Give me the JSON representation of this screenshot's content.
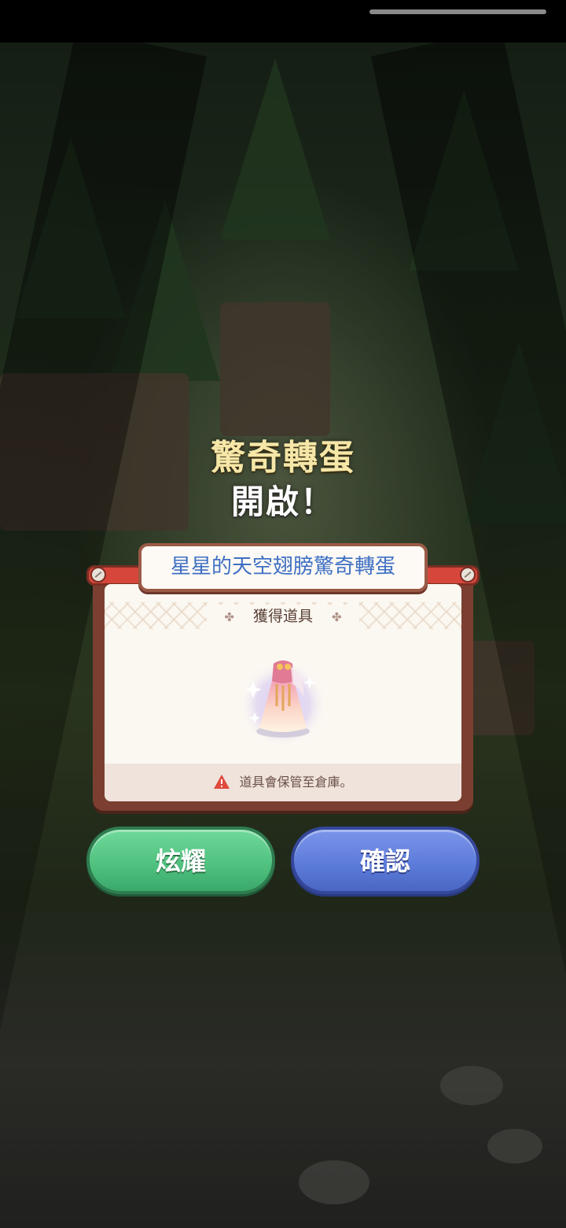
{
  "popup": {
    "title_line1": "驚奇轉蛋",
    "title_line2": "開啟！",
    "gacha_name": "星星的天空翅膀驚奇轉蛋",
    "reward_label": "獲得道具",
    "reward_item_icon": "dress-icon",
    "storage_notice": "道具會保管至倉庫。",
    "notice_icon": "warning-icon"
  },
  "buttons": {
    "show_off_label": "炫耀",
    "confirm_label": "確認"
  },
  "colors": {
    "title_gold": "#f6e7a8",
    "gacha_name_blue": "#3e70c4",
    "show_off_green": "#4fc07e",
    "confirm_blue": "#5b7ad8",
    "warning_red": "#e04a3c"
  }
}
